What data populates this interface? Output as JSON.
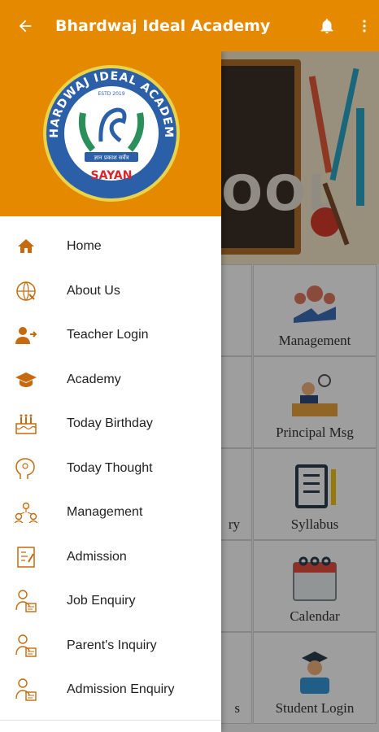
{
  "appbar": {
    "title": "Bhardwaj Ideal Academy",
    "bg_color": "#e58a00"
  },
  "drawer": {
    "logo": {
      "ring_text": "BHARDWAJ IDEAL ACADEMY",
      "estd": "ESTD 2019",
      "motto": "ज्ञान प्रकाश सर्वेत्र",
      "place": "SAYAN"
    },
    "items": [
      {
        "label": "Home",
        "icon": "home-icon"
      },
      {
        "label": "About Us",
        "icon": "about-icon"
      },
      {
        "label": "Teacher Login",
        "icon": "teacher-login-icon"
      },
      {
        "label": "Academy",
        "icon": "graduation-cap-icon"
      },
      {
        "label": "Today Birthday",
        "icon": "birthday-cake-icon"
      },
      {
        "label": "Today Thought",
        "icon": "thought-icon"
      },
      {
        "label": "Management",
        "icon": "management-icon"
      },
      {
        "label": "Admission",
        "icon": "admission-icon"
      },
      {
        "label": "Job Enquiry",
        "icon": "enquiry-icon"
      },
      {
        "label": "Parent's Inquiry",
        "icon": "enquiry-icon"
      },
      {
        "label": "Admission Enquiry",
        "icon": "enquiry-icon"
      }
    ]
  },
  "main": {
    "banner_text": "TO SCHOOL",
    "tiles_right": [
      "Management",
      "Principal Msg",
      "Syllabus",
      "Calendar",
      "Student Login"
    ],
    "tiles_left_partial": [
      "ry",
      "s"
    ]
  }
}
